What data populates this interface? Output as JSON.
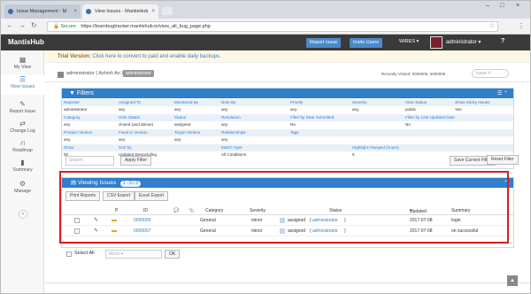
{
  "browser": {
    "tabs": [
      {
        "label": "Issue Management - M"
      },
      {
        "label": "View Issues - MantisHub"
      }
    ],
    "url_secure": "Secure",
    "url": "https://learnbugtracker.mantishub.io/view_all_bug_page.php"
  },
  "navbar": {
    "brand": "MantisHub",
    "report_issue": "Report Issue",
    "invite_users": "Invite Users",
    "project": "WIRES",
    "user": "administrator",
    "help": "?"
  },
  "sidebar": {
    "items": [
      {
        "label": "My View"
      },
      {
        "label": "View Issues"
      },
      {
        "label": "Report Issue"
      },
      {
        "label": "Change Log"
      },
      {
        "label": "Roadmap"
      },
      {
        "label": "Summary"
      },
      {
        "label": "Manage"
      }
    ]
  },
  "trial": {
    "prefix": "Trial Version:",
    "text": "Click here to convert to paid and enable daily backups."
  },
  "breadcrumb": {
    "user": "administrator ( Ashish An )",
    "badge": "administrator",
    "recently_visited": "Recently Visited: 0000006, 0000005",
    "issue_placeholder": "Issue #"
  },
  "filters": {
    "title": "Filters",
    "rows": [
      {
        "labels": [
          "Reporter",
          "Assigned To",
          "Monitored By",
          "Note By",
          "Priority",
          "Severity",
          "View Status",
          "Show Sticky Issues"
        ],
        "values": [
          "administrator",
          "any",
          "any",
          "any",
          "any",
          "any",
          "public",
          "Yes"
        ]
      },
      {
        "labels": [
          "Category",
          "Hide Status",
          "Status",
          "Resolution",
          "Filter by Date Submitted",
          "",
          "Filter by Last Updated Date",
          ""
        ],
        "values": [
          "any",
          "closed (and above)",
          "assigned",
          "any",
          "No",
          "",
          "No",
          ""
        ]
      },
      {
        "labels": [
          "Product Version",
          "Fixed in Version",
          "Target Version",
          "Relationships",
          "Tags",
          "",
          "",
          ""
        ],
        "values": [
          "any",
          "any",
          "any",
          "any",
          "",
          "",
          "",
          ""
        ]
      },
      {
        "labels": [
          "Show",
          "Sort by",
          "",
          "Match Type",
          "",
          "Highlight changed (hours)",
          "",
          ""
        ],
        "values": [
          "50",
          "Updated Descending",
          "",
          "All Conditions",
          "",
          "6",
          "",
          ""
        ]
      }
    ],
    "search_placeholder": "Search",
    "apply_filter": "Apply Filter",
    "save_current_filter": "Save Current Filter",
    "reset_filter": "Reset Filter"
  },
  "viewing": {
    "title": "Viewing Issues",
    "count": "1 - 2 / 2",
    "print_reports": "Print Reports",
    "csv_export": "CSV Export",
    "excel_export": "Excel Export",
    "columns": [
      "P",
      "ID",
      "Category",
      "Severity",
      "Status",
      "Updated",
      "Summary"
    ],
    "rows": [
      {
        "id": "0000005",
        "category": "General",
        "severity": "minor",
        "status": "assigned",
        "assignee": "administrator",
        "updated": "2017-07-08",
        "summary": "login"
      },
      {
        "id": "0000007",
        "category": "General",
        "severity": "minor",
        "status": "assigned",
        "assignee": "administrator",
        "updated": "2017-07-08",
        "summary": "on successful"
      }
    ],
    "select_all": "Select All",
    "move_placeholder": "Move",
    "ok": "OK"
  },
  "colors": {
    "accent": "#307ecc",
    "navbar": "#3a3a3a",
    "highlight": "#d81e1e"
  }
}
